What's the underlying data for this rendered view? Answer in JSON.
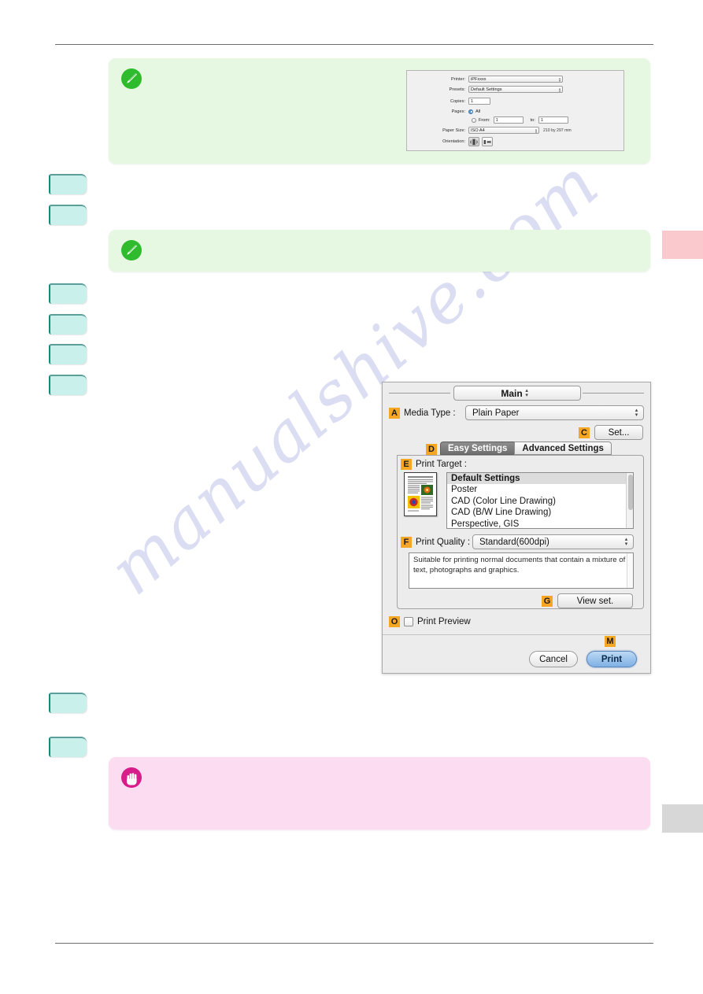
{
  "page": {
    "watermark_text": "manualshive.com"
  },
  "callouts": {
    "note1": {
      "icon": "pencil-note-icon",
      "text": ""
    },
    "note2": {
      "icon": "pencil-note-icon",
      "text": ""
    },
    "caution1": {
      "icon": "hand-caution-icon",
      "text": ""
    }
  },
  "steps": [
    {
      "label": ""
    },
    {
      "label": ""
    },
    {
      "label": ""
    },
    {
      "label": ""
    },
    {
      "label": ""
    },
    {
      "label": ""
    },
    {
      "label": ""
    },
    {
      "label": ""
    }
  ],
  "mini_print_dialog": {
    "rows": {
      "printer_label": "Printer:",
      "printer_value": "iPFxxxx",
      "presets_label": "Presets:",
      "presets_value": "Default Settings",
      "copies_label": "Copies:",
      "copies_value": "1",
      "pages_label": "Pages:",
      "pages_all": "All",
      "pages_from": "From:",
      "pages_from_value": "1",
      "pages_to": "to:",
      "pages_to_value": "1",
      "paper_size_label": "Paper Size:",
      "paper_size_value": "ISO A4",
      "paper_size_note": "210 by 297 mm",
      "orientation_label": "Orientation:"
    }
  },
  "dialog": {
    "tab_popup": {
      "value": "Main"
    },
    "media_type": {
      "badge": "A",
      "label": "Media Type :",
      "value": "Plain Paper"
    },
    "set_button": {
      "badge": "C",
      "label": "Set..."
    },
    "settings_tabs": {
      "badge": "D",
      "easy": "Easy Settings",
      "advanced": "Advanced Settings",
      "selected": "Easy Settings"
    },
    "print_target": {
      "badge": "E",
      "label": "Print Target :",
      "selected": "Default Settings",
      "options": [
        "Default Settings",
        "Poster",
        "CAD (Color Line Drawing)",
        "CAD (B/W Line Drawing)",
        "Perspective, GIS"
      ]
    },
    "print_quality": {
      "badge": "F",
      "label": "Print Quality :",
      "value": "Standard(600dpi)",
      "description": "Suitable for printing normal documents that contain a mixture of text, photographs and graphics."
    },
    "view_set": {
      "badge": "G",
      "label": "View set."
    },
    "print_preview": {
      "badge": "O",
      "label": "Print Preview",
      "checked": false
    },
    "footer": {
      "badge": "M",
      "cancel_label": "Cancel",
      "print_label": "Print"
    }
  },
  "colors": {
    "note_bg": "#e6f8e2",
    "note_icon": "#2ebb2e",
    "caution_bg": "#fbdcf0",
    "caution_icon": "#d71d8a",
    "badge_orange": "#f5a623",
    "step_box": "#c9f0ea",
    "edge_tab_pink": "#f9c9ce",
    "edge_tab_gray": "#d7d7d7",
    "print_button_blue": "#7fb0e4",
    "watermark": "#b9bce6"
  }
}
